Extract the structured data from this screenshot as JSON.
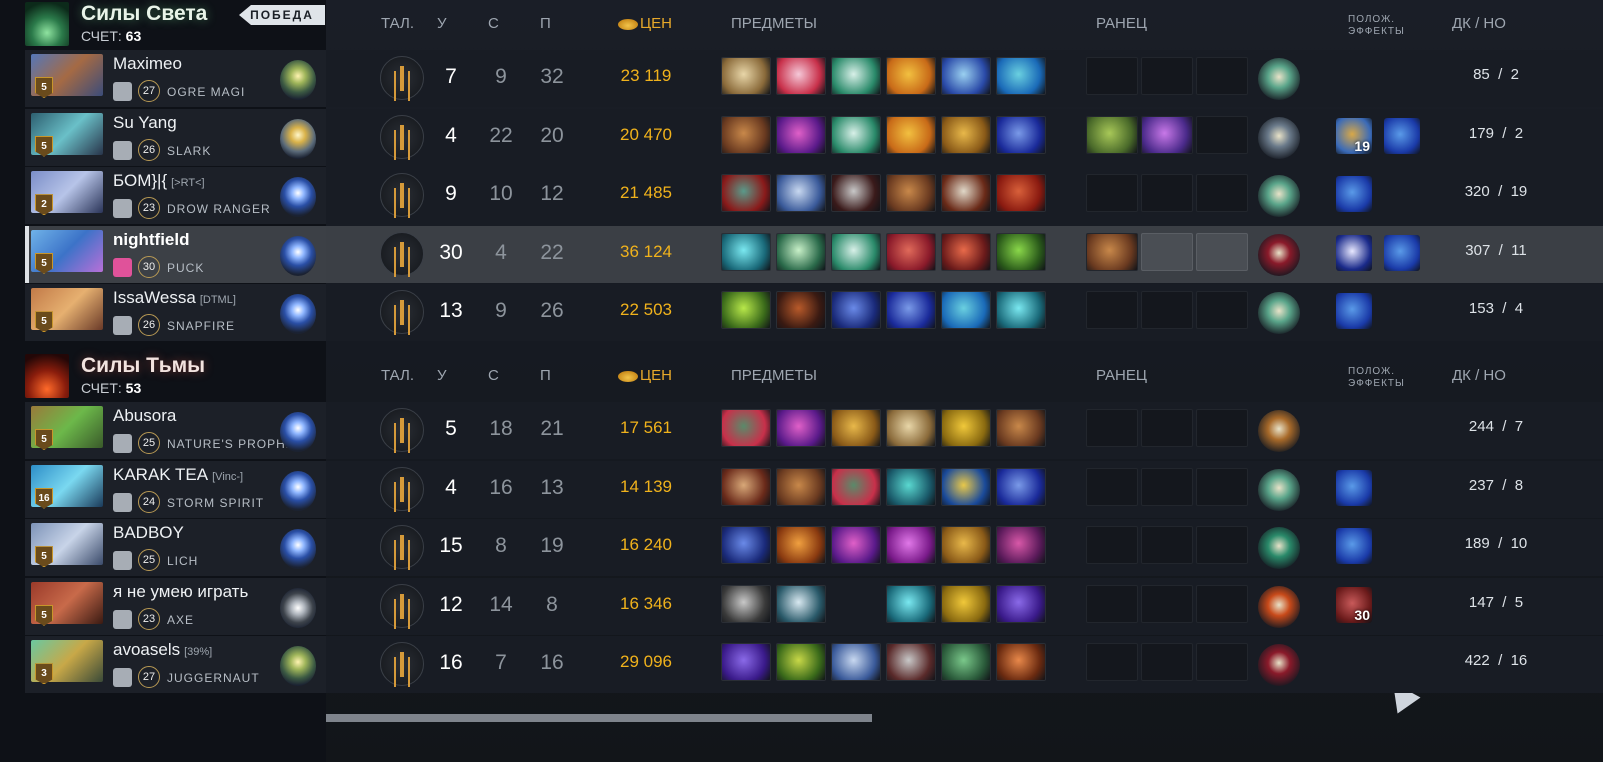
{
  "columns": {
    "talents": "ТАЛ.",
    "kills": "У",
    "deaths": "С",
    "assists": "П",
    "networth": "ЦЕН",
    "items": "ПРЕДМЕТЫ",
    "backpack": "РАНЕЦ",
    "buffs_line1": "ПОЛОЖ.",
    "buffs_line2": "ЭФФЕКТЫ",
    "lh": "ДК",
    "sep": "/",
    "dn": "НО"
  },
  "teams": [
    {
      "name": "Силы Света",
      "score_label": "СЧЕТ:",
      "score": "63",
      "result": "ПОБЕДА",
      "players": [
        {
          "name": "Maximeo",
          "tag": "",
          "level": "5",
          "hero_level": "27",
          "hero": "OGRE MAGI",
          "kills": "7",
          "deaths": "9",
          "assists": "32",
          "networth": "23 119",
          "last_hits": "85",
          "denies": "2",
          "backpack_light": false,
          "buffs": [],
          "neutral_color": "#5aa58a",
          "items": [
            "#8a6a3a,#e8d6a8",
            "#c8304a,#f5c8d8",
            "#2a8a6a,#d8f0e8",
            "#c86a18,#f2c040",
            "#2a4aa8,#9ad0f0",
            "#1a6ab8,#6ad0e0"
          ]
        },
        {
          "name": "Su Yang",
          "tag": "",
          "level": "5",
          "hero_level": "26",
          "hero": "SLARK",
          "kills": "4",
          "deaths": "22",
          "assists": "20",
          "networth": "20 470",
          "last_hits": "179",
          "denies": "2",
          "backpack_light": false,
          "buffs": [
            {
              "color": "#3a6ab8,#d8a848",
              "count": "19"
            },
            {
              "color": "#1a3aa8,#5a9ae8",
              "count": ""
            }
          ],
          "neutral_color": "#6a7a8a",
          "items": [
            "#6a3a20,#c8884a",
            "#5a1a8a,#e060c8",
            "#2a8a6a,#d8f0e8",
            "#c86a18,#f2c040",
            "#8a5a18,#e8b84a",
            "#1a2a9a,#7a9ae8"
          ],
          "backpack": [
            "#4a6a2a,#a8c858",
            "#4a2a8a,#c878e8"
          ]
        },
        {
          "name": "БОМ}|{",
          "tag": "[>RT<]",
          "level": "2",
          "hero_level": "23",
          "hero": "DROW RANGER",
          "kills": "9",
          "deaths": "10",
          "assists": "12",
          "networth": "21 485",
          "last_hits": "320",
          "denies": "19",
          "backpack_light": false,
          "buffs": [
            {
              "color": "#1a3aa8,#5a9ae8",
              "count": ""
            }
          ],
          "neutral_color": "#5aa58a",
          "items": [
            "#8a1a1a,#5a9a8a",
            "#3a5a9a,#c8d8f0",
            "#3a1a1a,#c8c8c8",
            "#6a3a20,#c8884a",
            "#6a2a18,#e0d8c8",
            "#8a1a10,#d8603a"
          ]
        },
        {
          "name": "nightfield",
          "tag": "",
          "level": "5",
          "hero_level": "30",
          "hero": "PUCK",
          "kills": "30",
          "deaths": "4",
          "assists": "22",
          "networth": "36 124",
          "last_hits": "307",
          "denies": "11",
          "backpack_light": true,
          "buffs": [
            {
              "color": "#1a2a8a,#e8e8ff",
              "count": ""
            },
            {
              "color": "#1a3aa8,#5a9ae8",
              "count": ""
            }
          ],
          "neutral_color": "#8a1a2a",
          "items": [
            "#1a6a7a,#7ae8f0",
            "#2a6a4a,#c8f0c8",
            "#2a8a6a,#d8f0e8",
            "#8a1a2a,#e06a5a",
            "#6a1a1a,#e86a4a",
            "#2a5a1a,#8ad84a"
          ],
          "backpack": [
            "#6a3a20,#c8884a"
          ]
        },
        {
          "name": "IssaWessa",
          "tag": "[DTML]",
          "level": "5",
          "hero_level": "26",
          "hero": "SNAPFIRE",
          "kills": "13",
          "deaths": "9",
          "assists": "26",
          "networth": "22 503",
          "last_hits": "153",
          "denies": "4",
          "backpack_light": false,
          "buffs": [
            {
              "color": "#1a3aa8,#5a9ae8",
              "count": ""
            }
          ],
          "neutral_color": "#5aa58a",
          "items": [
            "#3a6a1a,#b8e84a",
            "#3a1a12,#b85a2a",
            "#1a2a7a,#6a8ae8",
            "#1a2a9a,#7a9ae8",
            "#1a6ab8,#6ad0e0",
            "#1a6a7a,#7ae8f0"
          ]
        }
      ]
    },
    {
      "name": "Силы Тьмы",
      "score_label": "СЧЕТ:",
      "score": "53",
      "players": [
        {
          "name": "Abusora",
          "tag": "",
          "level": "5",
          "hero_level": "25",
          "hero": "NATURE'S PROPHET",
          "kills": "5",
          "deaths": "18",
          "assists": "21",
          "networth": "17 561",
          "last_hits": "244",
          "denies": "7",
          "backpack_light": false,
          "buffs": [],
          "neutral_color": "#a86a2a",
          "items": [
            "#c8304a,#5a8a6a",
            "#5a1a8a,#e060c8",
            "#8a5a18,#e8b84a",
            "#8a6a3a,#e8d6a8",
            "#8a6a10,#f0c83a",
            "#6a3a20,#c8884a"
          ]
        },
        {
          "name": "KARAK TEA",
          "tag": "[Vinc-]",
          "level": "16",
          "hero_level": "24",
          "hero": "STORM SPIRIT",
          "kills": "4",
          "deaths": "16",
          "assists": "13",
          "networth": "14 139",
          "last_hits": "237",
          "denies": "8",
          "backpack_light": false,
          "buffs": [
            {
              "color": "#1a3aa8,#5a9ae8",
              "count": ""
            }
          ],
          "neutral_color": "#5aa58a",
          "items": [
            "#6a2a1a,#d8a878",
            "#6a3a20,#c8884a",
            "#c8304a,#5a8a6a",
            "#1a5a6a,#5ad8d0",
            "#1a4a9a,#e8c84a",
            "#1a2a9a,#7a9ae8"
          ]
        },
        {
          "name": "BADBOY",
          "tag": "",
          "level": "5",
          "hero_level": "25",
          "hero": "LICH",
          "kills": "15",
          "deaths": "8",
          "assists": "19",
          "networth": "16 240",
          "last_hits": "189",
          "denies": "10",
          "backpack_light": false,
          "buffs": [
            {
              "color": "#1a3aa8,#5a9ae8",
              "count": ""
            }
          ],
          "neutral_color": "#2a8a6a",
          "items": [
            "#1a2a7a,#6a8ae8",
            "#8a3a10,#f0a040",
            "#5a1a8a,#e060c8",
            "#7a1a8a,#e078e8",
            "#8a5a18,#e8b84a",
            "#5a1a5a,#d858a8"
          ]
        },
        {
          "name": "я не умею играть",
          "tag": "",
          "level": "5",
          "hero_level": "23",
          "hero": "AXE",
          "kills": "12",
          "deaths": "14",
          "assists": "8",
          "networth": "16 346",
          "last_hits": "147",
          "denies": "5",
          "backpack_light": false,
          "buffs": [
            {
              "color": "#6a1a1a,#c85a5a",
              "count": "30"
            }
          ],
          "neutral_color": "#c84a1a",
          "items": [
            "#3a3a3a,#c8c8c8",
            "#2a5a6a,#d8e8f0",
            "",
            "#1a6a7a,#7ae8f0",
            "#8a6a10,#f0c83a",
            "#3a1a8a,#8a6ae8"
          ]
        },
        {
          "name": "avoasels",
          "tag": "[39%]",
          "level": "3",
          "hero_level": "27",
          "hero": "JUGGERNAUT",
          "kills": "16",
          "deaths": "7",
          "assists": "16",
          "networth": "29 096",
          "last_hits": "422",
          "denies": "16",
          "backpack_light": false,
          "buffs": [],
          "neutral_color": "#8a1a2a",
          "items": [
            "#3a1a8a,#8a6ae8",
            "#3a6a1a,#c8d848",
            "#3a5a9a,#c8d8f0",
            "#5a2a2a,#c8c8c8",
            "#2a5a3a,#7ac88a",
            "#6a2a10,#e8884a"
          ]
        }
      ]
    }
  ]
}
